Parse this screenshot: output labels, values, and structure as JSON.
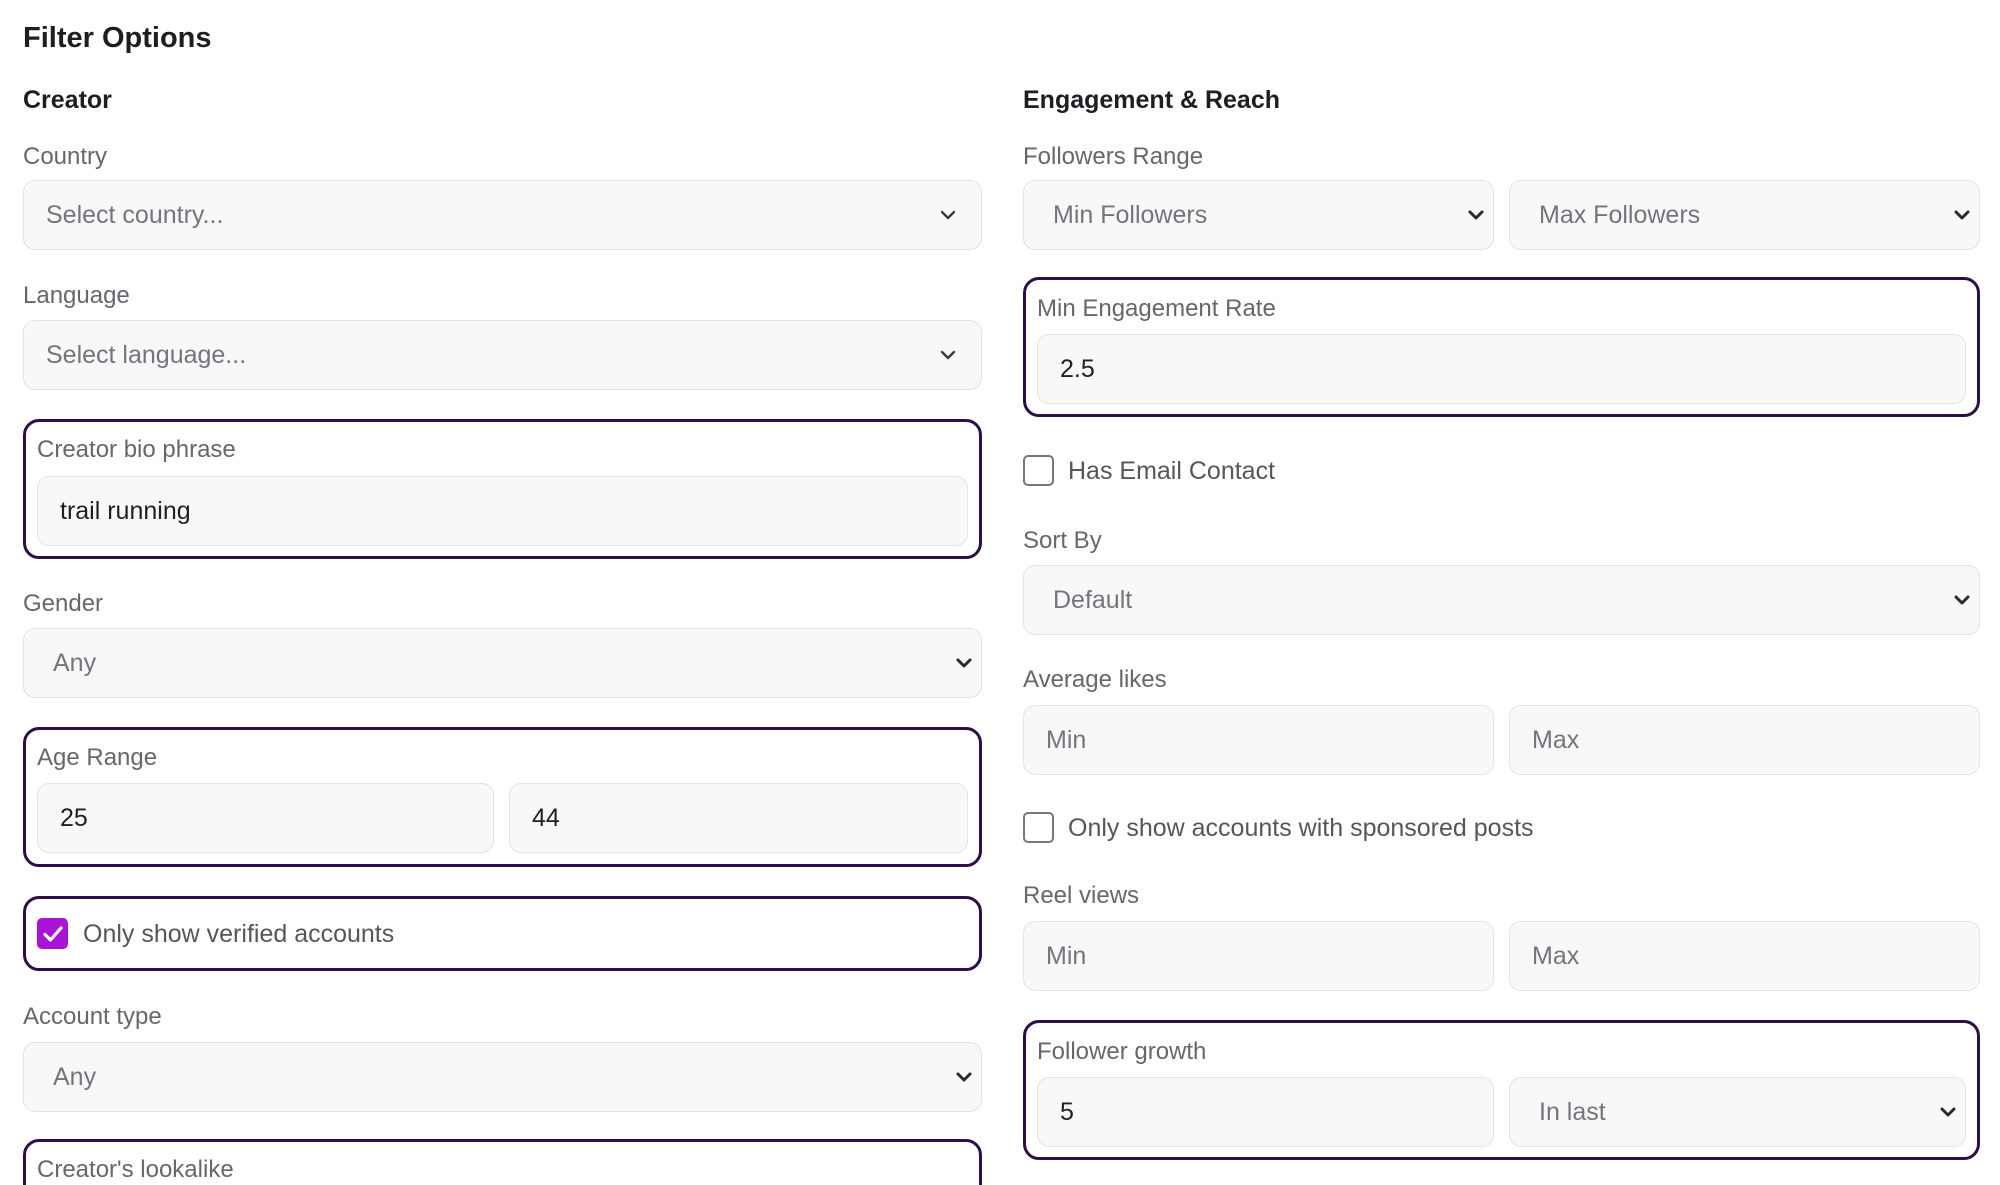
{
  "page_title": "Filter Options",
  "creator": {
    "title": "Creator",
    "country": {
      "label": "Country",
      "placeholder": "Select country..."
    },
    "language": {
      "label": "Language",
      "placeholder": "Select language..."
    },
    "bio": {
      "label": "Creator bio phrase",
      "value": "trail running"
    },
    "gender": {
      "label": "Gender",
      "value": "Any"
    },
    "age": {
      "label": "Age Range",
      "min": "25",
      "max": "44"
    },
    "verified": {
      "label": "Only show verified accounts",
      "checked": true
    },
    "account_type": {
      "label": "Account type",
      "value": "Any"
    },
    "lookalike": {
      "label": "Creator's lookalike"
    }
  },
  "engagement": {
    "title": "Engagement & Reach",
    "followers": {
      "label": "Followers Range",
      "min": "Min Followers",
      "max": "Max Followers"
    },
    "engagement_rate": {
      "label": "Min Engagement Rate",
      "value": "2.5"
    },
    "email": {
      "label": "Has Email Contact",
      "checked": false
    },
    "sort": {
      "label": "Sort By",
      "value": "Default"
    },
    "avg_likes": {
      "label": "Average likes",
      "min_placeholder": "Min",
      "max_placeholder": "Max"
    },
    "sponsored": {
      "label": "Only show accounts with sponsored posts",
      "checked": false
    },
    "reel_views": {
      "label": "Reel views",
      "min_placeholder": "Min",
      "max_placeholder": "Max"
    },
    "growth": {
      "label": "Follower growth",
      "value": "5",
      "period": "In last"
    }
  },
  "colors": {
    "highlight_border": "#2b0f46",
    "checkbox_checked": "#a814d6"
  },
  "icons": [
    "chevron-down-icon",
    "checkmark-icon"
  ]
}
